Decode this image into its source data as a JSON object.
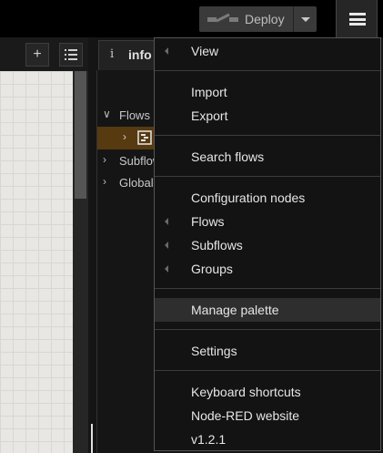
{
  "header": {
    "deploy_label": "Deploy",
    "colors": {
      "header_bg": "#000000",
      "deploy_bg": "#3a3a3a"
    }
  },
  "workspace": {
    "add_icon": "plus-icon",
    "list_icon": "list-icon",
    "canvas_color": "#e9e7e3"
  },
  "sidebar": {
    "tab_label": "info",
    "tab_icon": "info-icon",
    "tree": [
      {
        "label": "Flows",
        "expanded": true
      },
      {
        "label": "Subflows",
        "expanded": false
      },
      {
        "label": "Global",
        "expanded": false
      }
    ],
    "selected_flow_color": "#573a10"
  },
  "menu": {
    "items": [
      {
        "label": "View",
        "submenu": true
      },
      {
        "label": "Import",
        "submenu": false
      },
      {
        "label": "Export",
        "submenu": false
      },
      {
        "label": "Search flows",
        "submenu": false
      },
      {
        "label": "Configuration nodes",
        "submenu": false
      },
      {
        "label": "Flows",
        "submenu": true
      },
      {
        "label": "Subflows",
        "submenu": true
      },
      {
        "label": "Groups",
        "submenu": true
      },
      {
        "label": "Manage palette",
        "submenu": false,
        "highlighted": true
      },
      {
        "label": "Settings",
        "submenu": false
      },
      {
        "label": "Keyboard shortcuts",
        "submenu": false
      },
      {
        "label": "Node-RED website",
        "submenu": false
      },
      {
        "label": "v1.2.1",
        "submenu": false
      }
    ]
  }
}
